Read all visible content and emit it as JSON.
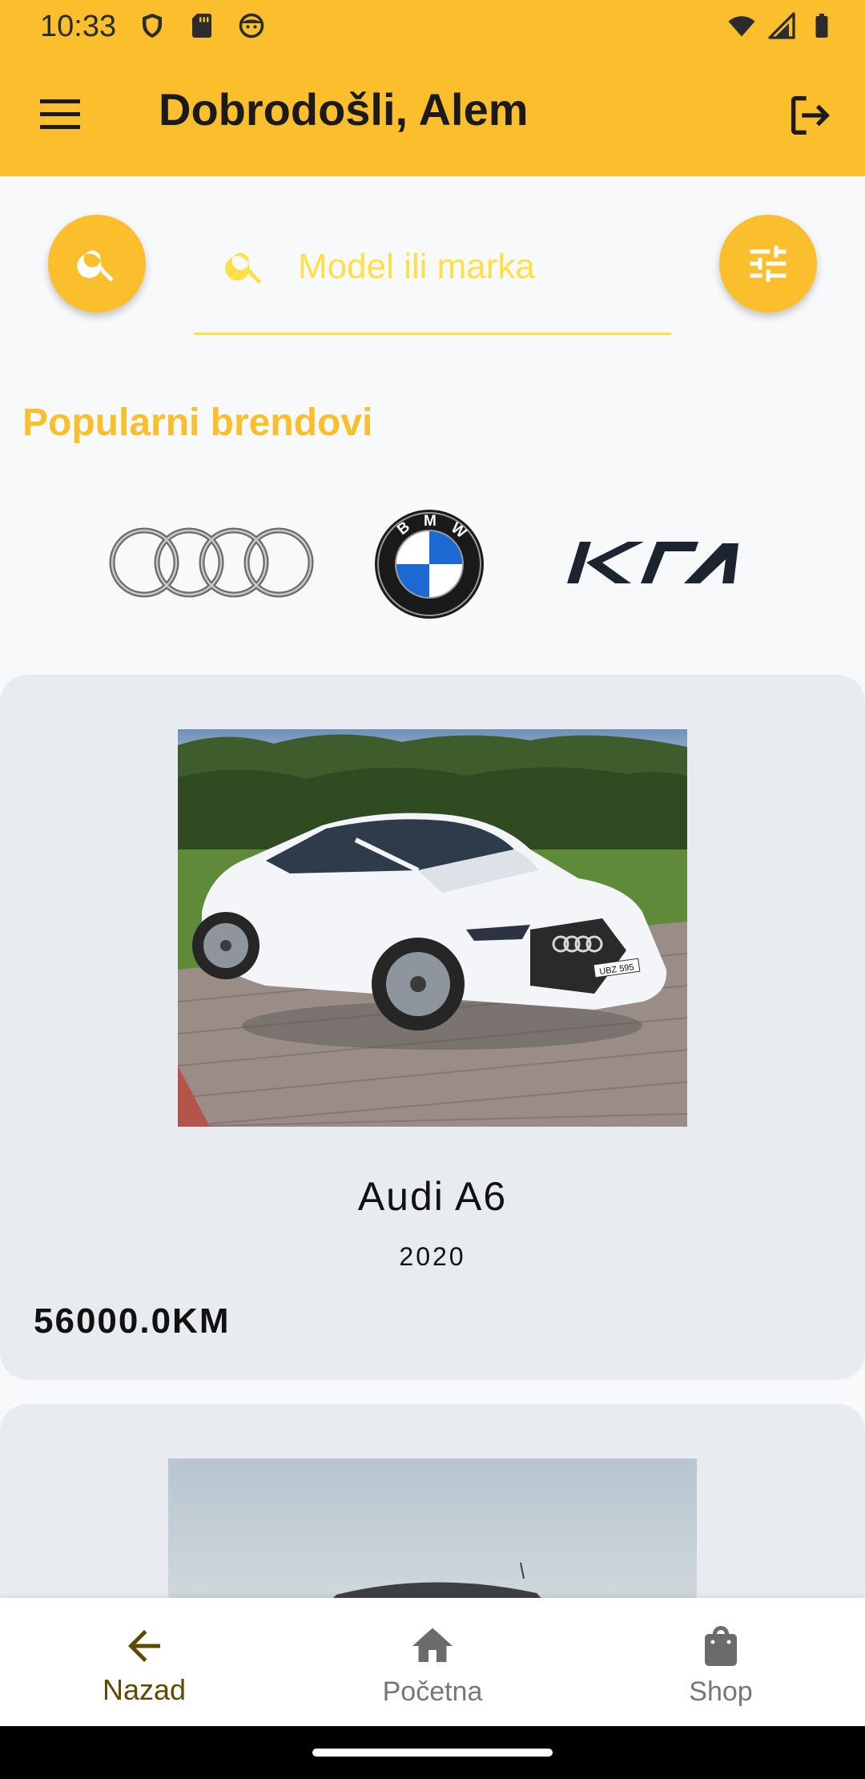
{
  "status_bar": {
    "time": "10:33"
  },
  "app_bar": {
    "title": "Dobrodošli, Alem"
  },
  "search": {
    "placeholder": "Model ili marka",
    "value": ""
  },
  "popular_brands": {
    "title": "Popularni brendovi",
    "brands": [
      {
        "name": "Audi",
        "icon": "audi-logo"
      },
      {
        "name": "BMW",
        "icon": "bmw-logo"
      },
      {
        "name": "Kia",
        "icon": "kia-logo"
      }
    ]
  },
  "listings": [
    {
      "name": "Audi A6",
      "year": "2020",
      "price": "56000.0KM",
      "plate": "UBZ 595"
    }
  ],
  "bottom_nav": {
    "items": [
      {
        "label": "Nazad",
        "icon": "arrow-back-icon",
        "active": true
      },
      {
        "label": "Početna",
        "icon": "home-icon",
        "active": false
      },
      {
        "label": "Shop",
        "icon": "shopping-bag-icon",
        "active": false
      }
    ]
  },
  "colors": {
    "accent": "#fbbf2d",
    "search_placeholder": "#fde047",
    "card_background": "#e8ecf1",
    "active_nav": "#5c4a00"
  }
}
